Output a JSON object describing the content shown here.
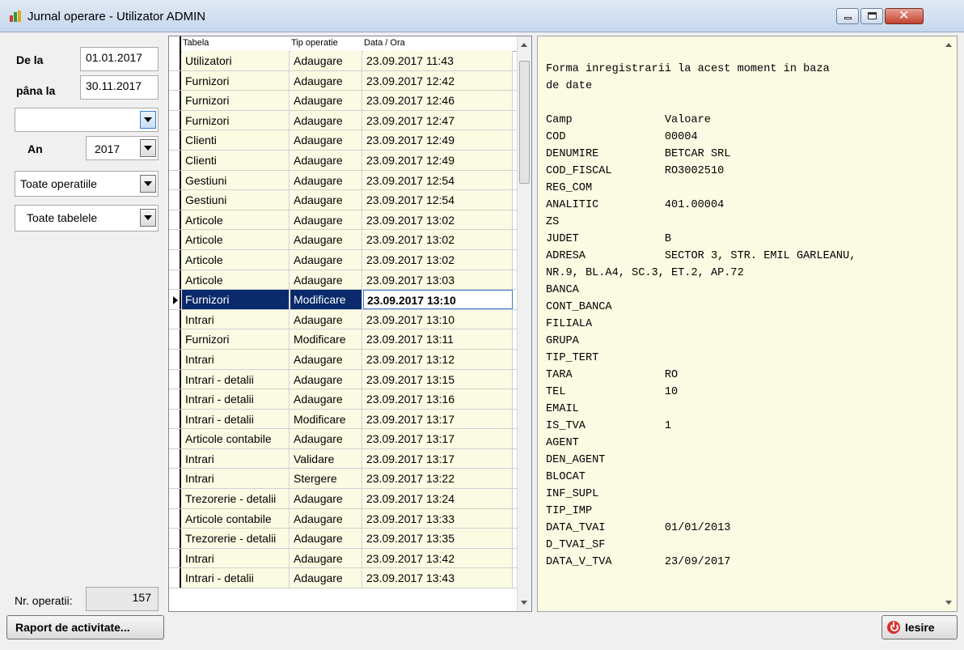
{
  "window": {
    "title": "Jurnal operare - Utilizator ADMIN",
    "controls": [
      "minimize-icon",
      "maximize-icon",
      "close-icon"
    ]
  },
  "filters": {
    "from_label": "De la",
    "from_value": "01.01.2017",
    "to_label": "pâna la",
    "to_value": "30.11.2017",
    "user_combo_value": "",
    "year_label": "An",
    "year_value": "2017",
    "operations_value": "Toate operatiile",
    "tables_value": "Toate tabelele"
  },
  "grid": {
    "headers": [
      "Tabela",
      "Tip operatie",
      "Data / Ora"
    ],
    "selected_index": 12,
    "rows": [
      [
        "Utilizatori",
        "Adaugare",
        "23.09.2017 11:43"
      ],
      [
        "Furnizori",
        "Adaugare",
        "23.09.2017 12:42"
      ],
      [
        "Furnizori",
        "Adaugare",
        "23.09.2017 12:46"
      ],
      [
        "Furnizori",
        "Adaugare",
        "23.09.2017 12:47"
      ],
      [
        "Clienti",
        "Adaugare",
        "23.09.2017 12:49"
      ],
      [
        "Clienti",
        "Adaugare",
        "23.09.2017 12:49"
      ],
      [
        "Gestiuni",
        "Adaugare",
        "23.09.2017 12:54"
      ],
      [
        "Gestiuni",
        "Adaugare",
        "23.09.2017 12:54"
      ],
      [
        "Articole",
        "Adaugare",
        "23.09.2017 13:02"
      ],
      [
        "Articole",
        "Adaugare",
        "23.09.2017 13:02"
      ],
      [
        "Articole",
        "Adaugare",
        "23.09.2017 13:02"
      ],
      [
        "Articole",
        "Adaugare",
        "23.09.2017 13:03"
      ],
      [
        "Furnizori",
        "Modificare",
        "23.09.2017 13:10"
      ],
      [
        "Intrari",
        "Adaugare",
        "23.09.2017 13:10"
      ],
      [
        "Furnizori",
        "Modificare",
        "23.09.2017 13:11"
      ],
      [
        "Intrari",
        "Adaugare",
        "23.09.2017 13:12"
      ],
      [
        "Intrari - detalii",
        "Adaugare",
        "23.09.2017 13:15"
      ],
      [
        "Intrari - detalii",
        "Adaugare",
        "23.09.2017 13:16"
      ],
      [
        "Intrari - detalii",
        "Modificare",
        "23.09.2017 13:17"
      ],
      [
        "Articole contabile",
        "Adaugare",
        "23.09.2017 13:17"
      ],
      [
        "Intrari",
        "Validare",
        "23.09.2017 13:17"
      ],
      [
        "Intrari",
        "Stergere",
        "23.09.2017 13:22"
      ],
      [
        "Trezorerie - detalii",
        "Adaugare",
        "23.09.2017 13:24"
      ],
      [
        "Articole contabile",
        "Adaugare",
        "23.09.2017 13:33"
      ],
      [
        "Trezorerie - detalii",
        "Adaugare",
        "23.09.2017 13:35"
      ],
      [
        "Intrari",
        "Adaugare",
        "23.09.2017 13:42"
      ],
      [
        "Intrari - detalii",
        "Adaugare",
        "23.09.2017 13:43"
      ]
    ]
  },
  "memo": {
    "lines": [
      "Forma inregistrarii la acest moment in baza",
      "de date",
      "",
      "Camp              Valoare",
      "COD               00004",
      "DENUMIRE          BETCAR SRL",
      "COD_FISCAL        RO3002510",
      "REG_COM",
      "ANALITIC          401.00004",
      "ZS",
      "JUDET             B",
      "ADRESA            SECTOR 3, STR. EMIL GARLEANU,",
      "NR.9, BL.A4, SC.3, ET.2, AP.72",
      "BANCA",
      "CONT_BANCA",
      "FILIALA",
      "GRUPA",
      "TIP_TERT",
      "TARA              RO",
      "TEL               10",
      "EMAIL",
      "IS_TVA            1",
      "AGENT",
      "DEN_AGENT",
      "BLOCAT",
      "INF_SUPL",
      "TIP_IMP",
      "DATA_TVAI         01/01/2013",
      "D_TVAI_SF",
      "DATA_V_TVA        23/09/2017"
    ]
  },
  "footer": {
    "count_label": "Nr. operatii:",
    "count_value": "157",
    "report_button": "Raport de activitate...",
    "exit_button": "Iesire"
  }
}
